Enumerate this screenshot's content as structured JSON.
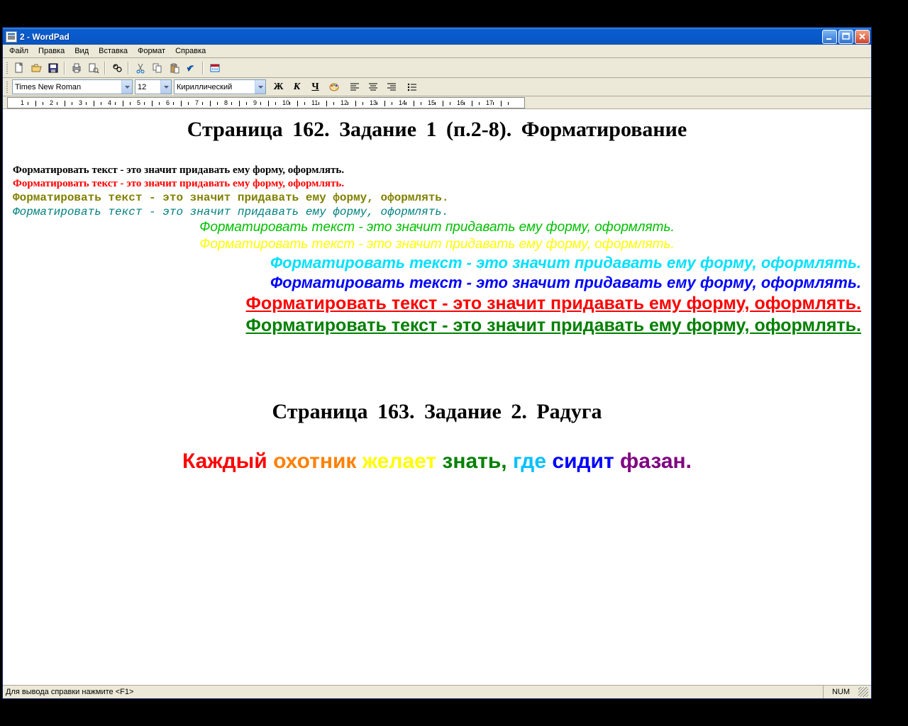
{
  "window": {
    "title": "2 - WordPad"
  },
  "menu": {
    "file": "Файл",
    "edit": "Правка",
    "view": "Вид",
    "insert": "Вставка",
    "format": "Формат",
    "help": "Справка"
  },
  "format_toolbar": {
    "font_name": "Times New Roman",
    "font_size": "12",
    "charset": "Кириллический",
    "bold": "Ж",
    "italic": "К",
    "underline": "Ч"
  },
  "document": {
    "heading1": "Страница 162.    Задание 1 (п.2-8).    Форматирование",
    "line1": "Форматировать текст - это значит придавать ему форму, оформлять.",
    "line2": "Форматировать текст - это значит придавать ему форму, оформлять.",
    "line3": "Форматировать текст - это значит придавать ему форму, оформлять.",
    "line4": "Форматировать текст - это значит придавать ему форму, оформлять.",
    "line5": "Форматировать текст - это значит придавать ему форму, оформлять.",
    "line6": "Форматировать текст - это значит придавать ему форму, оформлять.",
    "line7": "Форматировать текст - это значит придавать ему форму, оформлять.",
    "line8": "Форматировать текст - это значит придавать ему форму, оформлять.",
    "line9": "Форматировать текст - это значит придавать ему форму, оформлять.",
    "line10": "Форматировать текст - это значит придавать ему форму, оформлять.",
    "heading2": "Страница 163.    Задание 2. Радуга",
    "rainbow": {
      "w1": "Каждый",
      "w2": "охотник",
      "w3": "желает",
      "w4": "знать,",
      "w5": "где",
      "w6": "сидит",
      "w7": "фазан."
    }
  },
  "rainbow_colors": {
    "w1": "#ff0000",
    "w2": "#ff8000",
    "w3": "#ffff00",
    "w4": "#008000",
    "w5": "#00c0ff",
    "w6": "#0000ff",
    "w7": "#800080"
  },
  "ruler": {
    "ticks": [
      "1",
      "2",
      "3",
      "4",
      "5",
      "6",
      "7",
      "8",
      "9",
      "10",
      "11",
      "12",
      "13",
      "14",
      "15",
      "16",
      "17"
    ]
  },
  "statusbar": {
    "hint": "Для вывода справки нажмите <F1>",
    "num": "NUM"
  }
}
